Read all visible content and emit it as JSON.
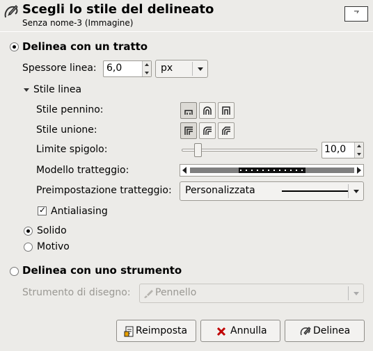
{
  "header": {
    "title": "Scegli lo stile del delineato",
    "subtitle": "Senza nome-3 (Immagine)"
  },
  "stroke_line": {
    "label": "Delinea con un tratto",
    "selected": true,
    "thickness_label": "Spessore linea:",
    "thickness_value": "6,0",
    "unit_value": "px",
    "line_style_label": "Stile linea",
    "cap_label": "Stile pennino:",
    "join_label": "Stile unione:",
    "miter_label": "Limite spigolo:",
    "miter_value": "10,0",
    "miter_fraction": 0.1,
    "dash_pattern_label": "Modello tratteggio:",
    "dash_preset_label": "Preimpostazione tratteggio:",
    "dash_preset_value": "Personalizzata",
    "antialias_label": "Antialiasing",
    "antialias_checked": true,
    "solid_label": "Solido",
    "pattern_label": "Motivo",
    "fill_mode": "solid"
  },
  "stroke_tool": {
    "label": "Delinea con uno strumento",
    "selected": false,
    "tool_label": "Strumento di disegno:",
    "tool_value": "Pennello"
  },
  "buttons": {
    "reset": "Reimposta",
    "cancel": "Annulla",
    "stroke": "Delinea"
  }
}
